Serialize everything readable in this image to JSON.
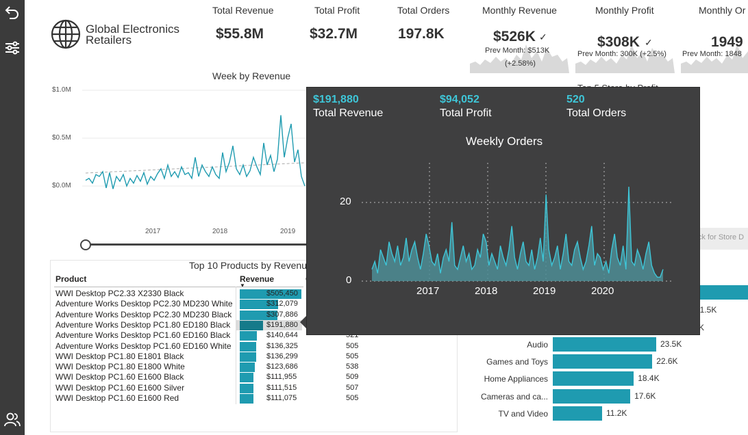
{
  "kpis": [
    {
      "title": "Total Revenue",
      "value": "$55.8M"
    },
    {
      "title": "Total Profit",
      "value": "$32.7M"
    },
    {
      "title": "Total Orders",
      "value": "197.8K"
    }
  ],
  "monthly": [
    {
      "title": "Monthly Revenue",
      "value": "$526K",
      "check": "✓",
      "prev": "Prev Month: $513K",
      "change": "(+2.58%)"
    },
    {
      "title": "Monthly Profit",
      "value": "$308K",
      "check": "✓",
      "prev": "Prev Month: 300K (+2.5%)"
    },
    {
      "title": "Monthly Or",
      "value": "1949",
      "prev": "Prev Month: 1848"
    }
  ],
  "logo": {
    "line1": "Global Electronics",
    "line2": "Retailers"
  },
  "week_chart": {
    "title": "Week by Revenue",
    "y_labels": [
      "$1.0M",
      "$0.5M",
      "$0.0M"
    ],
    "x_labels": [
      "2017",
      "2018",
      "2019"
    ]
  },
  "partial_text": {
    "top5_store": "Top 5 Store by Profit",
    "click_store": "lick for Store D",
    "val_31_5k": "31.5K",
    "val_k": "K"
  },
  "products": {
    "title": "Top 10 Products by Revenue",
    "col_product": "Product",
    "col_revenue": "Revenue",
    "col_orders": "O",
    "rows": [
      {
        "name": "WWI Desktop PC2.33 X2330 Black",
        "revenue": "$505,450",
        "orders": "",
        "frac": 1.0
      },
      {
        "name": "Adventure Works Desktop PC2.30 MD230 White",
        "revenue": "$312,079",
        "orders": "",
        "frac": 0.617
      },
      {
        "name": "Adventure Works Desktop PC2.30 MD230 Black",
        "revenue": "$307,886",
        "orders": "",
        "frac": 0.609
      },
      {
        "name": "Adventure Works Desktop PC1.80 ED180 Black",
        "revenue": "$191,880",
        "orders": "",
        "frac": 0.38
      },
      {
        "name": "Adventure Works Desktop PC1.60 ED160 Black",
        "revenue": "$140,644",
        "orders": "521",
        "frac": 0.278
      },
      {
        "name": "Adventure Works Desktop PC1.60 ED160 White",
        "revenue": "$136,325",
        "orders": "505",
        "frac": 0.27
      },
      {
        "name": "WWI Desktop PC1.80 E1801 Black",
        "revenue": "$136,299",
        "orders": "505",
        "frac": 0.27
      },
      {
        "name": "WWI Desktop PC1.80 E1800 White",
        "revenue": "$123,686",
        "orders": "538",
        "frac": 0.245
      },
      {
        "name": "WWI Desktop PC1.60 E1600 Black",
        "revenue": "$111,955",
        "orders": "509",
        "frac": 0.221
      },
      {
        "name": "WWI Desktop PC1.60 E1600 Silver",
        "revenue": "$111,515",
        "orders": "507",
        "frac": 0.221
      },
      {
        "name": "WWI Desktop PC1.60 E1600 Red",
        "revenue": "$111,075",
        "orders": "505",
        "frac": 0.22
      }
    ]
  },
  "categories": [
    {
      "name": "Audio",
      "value": "23.5K",
      "num": 23.5
    },
    {
      "name": "Games and Toys",
      "value": "22.6K",
      "num": 22.6
    },
    {
      "name": "Home Appliances",
      "value": "18.4K",
      "num": 18.4
    },
    {
      "name": "Cameras and ca...",
      "value": "17.6K",
      "num": 17.6
    },
    {
      "name": "TV and Video",
      "value": "11.2K",
      "num": 11.2
    }
  ],
  "tooltip": {
    "revenue": "$191,880",
    "revenue_label": "Total Revenue",
    "profit": "$94,052",
    "profit_label": "Total Profit",
    "orders": "520",
    "orders_label": "Total Orders",
    "chart_title": "Weekly Orders",
    "y_labels": [
      "20",
      "0"
    ],
    "x_labels": [
      "2017",
      "2018",
      "2019",
      "2020"
    ]
  },
  "colors": {
    "accent": "#1f9bb0",
    "tooltip_bg": "#3f3f40",
    "tooltip_accent": "#3ec6d8"
  },
  "chart_data": [
    {
      "type": "line",
      "title": "Week by Revenue",
      "ylim": [
        0,
        1000000
      ],
      "x_ticks": [
        "2017",
        "2018",
        "2019"
      ],
      "note": "weekly revenue series, approximated",
      "series": [
        {
          "values": [
            0.06,
            0.08,
            0.03,
            0.12,
            0.1,
            0.15,
            -0.02,
            0.14,
            -0.03,
            0.1,
            0.05,
            0.12,
            0.0,
            0.08,
            0.03,
            0.11,
            0.05,
            0.14,
            0.02,
            0.1,
            0.06,
            0.13,
            0.18,
            0.08,
            0.22,
            0.1,
            0.15,
            0.09,
            0.2,
            0.12,
            0.14,
            0.08,
            0.3,
            0.1,
            0.22,
            0.15,
            0.1,
            0.2,
            0.12,
            0.08,
            0.35,
            0.15,
            0.25,
            0.42,
            0.18,
            0.12,
            0.22,
            0.1,
            0.16,
            0.3,
            0.2,
            0.12,
            0.45,
            0.22,
            0.32,
            0.15,
            0.28,
            0.74,
            0.3,
            0.5,
            0.65,
            0.25,
            0.38,
            0.1,
            0.0
          ]
        }
      ]
    },
    {
      "type": "area",
      "title": "Weekly Orders",
      "x_ticks": [
        "2017",
        "2018",
        "2019",
        "2020"
      ],
      "y_ticks": [
        0,
        20
      ],
      "ylim": [
        0,
        25
      ],
      "series": [
        {
          "values": [
            3,
            5,
            2,
            8,
            6,
            4,
            10,
            7,
            5,
            9,
            4,
            6,
            11,
            5,
            8,
            10,
            6,
            3,
            7,
            12,
            9,
            5,
            4,
            7,
            2,
            6,
            8,
            5,
            15,
            4,
            3,
            6,
            9,
            5,
            7,
            3,
            4,
            8,
            6,
            12,
            10,
            4,
            7,
            5,
            3,
            9,
            6,
            4,
            8,
            14,
            6,
            3,
            7,
            10,
            5,
            4,
            8,
            3,
            6,
            11,
            5,
            22,
            8,
            4,
            6,
            9,
            3,
            7,
            12,
            5,
            4,
            8,
            10,
            6,
            3,
            5,
            9,
            14,
            4,
            7,
            6,
            3,
            5,
            2,
            8,
            12,
            6,
            4,
            9,
            3,
            24,
            5,
            4,
            8,
            6,
            3,
            7,
            10,
            4,
            2,
            1,
            1,
            3
          ]
        }
      ]
    },
    {
      "type": "bar",
      "title": "",
      "categories": [
        "Audio",
        "Games and Toys",
        "Home Appliances",
        "Cameras and ca...",
        "TV and Video"
      ],
      "values": [
        23.5,
        22.6,
        18.4,
        17.6,
        11.2
      ]
    }
  ]
}
